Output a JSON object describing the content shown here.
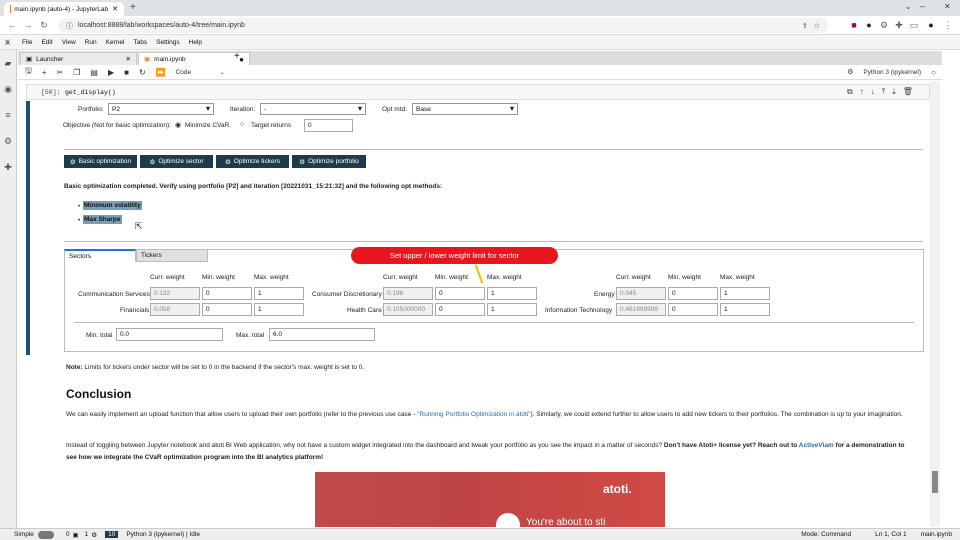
{
  "browser": {
    "tab_title": "main.ipynb (auto-4) - JupyterLab",
    "url": "localhost:8888/lab/workspaces/auto-4/tree/main.ipynb"
  },
  "menu": [
    "File",
    "Edit",
    "View",
    "Run",
    "Kernel",
    "Tabs",
    "Settings",
    "Help"
  ],
  "doc_tabs": [
    "Launcher",
    "main.ipynb"
  ],
  "toolbar": {
    "cell_type": "Code",
    "kernel": "Python 3 (ipykernel)"
  },
  "cell": {
    "prompt": "[50]:",
    "code": "get_display()"
  },
  "widget": {
    "portfolio_label": "Portfolio:",
    "portfolio_value": "P2",
    "iteration_label": "Iteration:",
    "iteration_value": "-",
    "optmtd_label": "Opt mtd:",
    "optmtd_value": "Base",
    "objective_label": "Objective (Not for basic optimization):",
    "minimize_cvar": "Minimize CVaR",
    "target_returns": "Target returns",
    "target_value": "0",
    "buttons": [
      "Basic optimization",
      "Optimize sector",
      "Optimize tickers",
      "Optimize portfolio"
    ],
    "result_msg": "Basic optimization completed. Verify using portfolio [P2] and iteration [20221031_15:21:32] and the following opt methods:",
    "methods": [
      "Minimum volatility",
      "Max Sharpe"
    ],
    "tabs": [
      "Sectors",
      "Tickers"
    ],
    "callout": "Set upper / lower weight limit for sector",
    "col_headers": [
      "Curr. weight",
      "Min. weight",
      "Max. weight"
    ],
    "sectors": [
      {
        "name": "Communication Services",
        "curr": "0.132",
        "min": "0",
        "max": "1"
      },
      {
        "name": "Financials",
        "curr": "0.058",
        "min": "0",
        "max": "1"
      },
      {
        "name": "Consumer Discretionary",
        "curr": "0.198",
        "min": "0",
        "max": "1"
      },
      {
        "name": "Health Care",
        "curr": "0.105000000",
        "min": "0",
        "max": "1"
      },
      {
        "name": "Energy",
        "curr": "0.045",
        "min": "0",
        "max": "1"
      },
      {
        "name": "Information Technology",
        "curr": "0.461999999",
        "min": "0",
        "max": "1"
      }
    ],
    "min_total_label": "Min. total",
    "min_total": "0.0",
    "max_total_label": "Max. total",
    "max_total": "6.0"
  },
  "note": {
    "bold": "Note:",
    "text": " Limits for tickers under sector will be set to 0 in the backend if the sector's max. weight is set to 0."
  },
  "conclusion": {
    "heading": "Conclusion",
    "p1a": "We can easily implement an upload function that allow users to upload their own portfolio (refer to the previous use case - ",
    "p1link": "\"Running Portfolio Optimization in atoti\"",
    "p1b": "). Similarly, we could extend further to allow users to add new tickers to their portfolios. The combination is up to your imagination.",
    "p2a": "Instead of toggling between Jupyter notebook and atoti BI Web application, why not have a custom widget integrated into the dashboard and tweak your portfolio as you see the impact in a matter of seconds? ",
    "p2b": "Don't have Atoti+ license yet? Reach out to ",
    "p2link": "ActiveViam",
    "p2c": " for a demonstration to see how we integrate the CVaR optimization program into the BI analytics platform!",
    "video_brand": "atoti.",
    "video_caption": "You're about to sti"
  },
  "status": {
    "mode": "Simple",
    "nums": "0",
    "nums2": "1",
    "kernel_count": "10",
    "kernel": "Python 3 (ipykernel) | Idle",
    "cmd_mode": "Mode: Command",
    "ln": "Ln 1, Col 1",
    "file": "main.ipynb"
  },
  "colors": {
    "button_bg": "#1e3b4c",
    "highlight": "#76a0b9",
    "callout": "#e8171f",
    "active_cell": "#1d4f7e"
  }
}
